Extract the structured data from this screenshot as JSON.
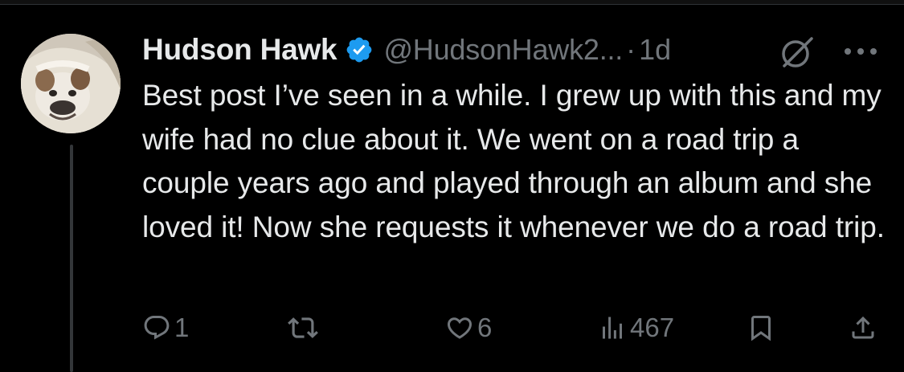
{
  "post": {
    "author": {
      "display_name": "Hudson Hawk",
      "handle": "@HudsonHawk2...",
      "verified": true
    },
    "separator": "·",
    "timestamp": "1d",
    "text": "Best post I’ve seen in a while. I grew up with this and my wife had no clue about it. We went on a road trip a couple years ago and played through an album and she loved it! Now she requests it whenever we do a road trip."
  },
  "actions": {
    "replies": "1",
    "reposts": "",
    "likes": "6",
    "views": "467"
  },
  "icons": {
    "avatar": "bulldog-avatar",
    "verified": "verified-badge-icon",
    "grok": "grok-icon",
    "more": "more-options-icon",
    "reply": "reply-icon",
    "repost": "repost-icon",
    "like": "heart-icon",
    "views": "views-icon",
    "bookmark": "bookmark-icon",
    "share": "share-icon"
  },
  "colors": {
    "background": "#000000",
    "text_primary": "#e7e9ea",
    "text_secondary": "#71767b",
    "verified_blue": "#1d9bf0",
    "thread_line": "#333639"
  }
}
